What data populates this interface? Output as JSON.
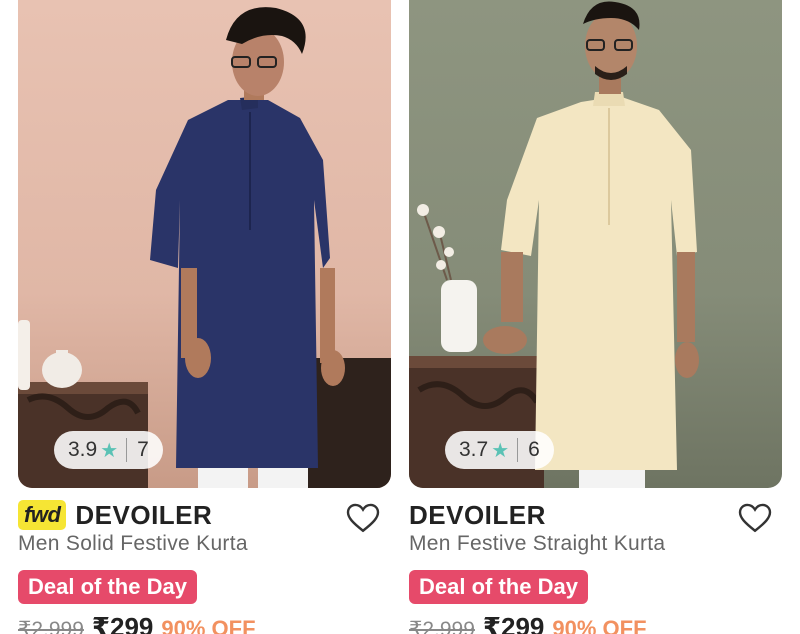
{
  "products": [
    {
      "badge": "fwd",
      "brand": "DEVOILER",
      "name": "Men Solid Festive Kurta",
      "rating": "3.9",
      "rating_count": "7",
      "deal": "Deal of the Day",
      "mrp": "₹2,999",
      "price": "₹299",
      "discount": "90% OFF",
      "image_icon": "blue-kurta-model-photo"
    },
    {
      "brand": "DEVOILER",
      "name": "Men Festive Straight Kurta",
      "rating": "3.7",
      "rating_count": "6",
      "deal": "Deal of the Day",
      "mrp": "₹2,999",
      "price": "₹299",
      "discount": "90% OFF",
      "image_icon": "cream-kurta-model-photo"
    }
  ],
  "colors": {
    "deal_bg": "#e64a6a",
    "discount": "#f29160",
    "star": "#5bc2b5",
    "fwd_badge": "#f6e534"
  },
  "icons": {
    "rating": "star-icon",
    "wishlist": "heart-icon"
  }
}
